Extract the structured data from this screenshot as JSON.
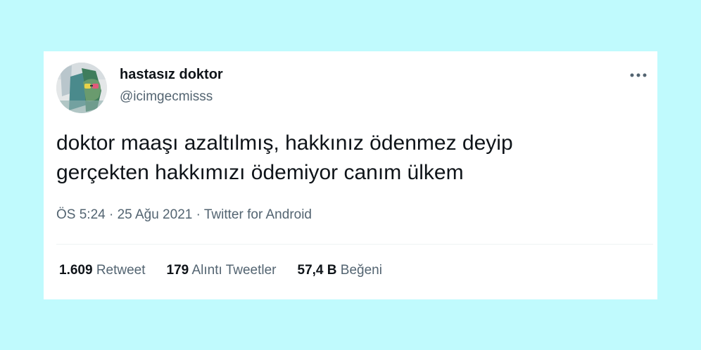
{
  "user": {
    "display_name": "hastasız doktor",
    "handle": "@icimgecmisss",
    "avatar_icon": "profile-photo"
  },
  "tweet": {
    "lines": [
      "doktor maaşı azaltılmış, hakkınız ödenmez deyip",
      "gerçekten hakkımızı ödemiyor canım ülkem"
    ]
  },
  "meta": {
    "time": "ÖS 5:24",
    "sep1": "·",
    "date": "25 Ağu 2021",
    "sep2": "·",
    "source": "Twitter for Android"
  },
  "stats": {
    "retweets": {
      "count": "1.609",
      "label": "Retweet"
    },
    "quotes": {
      "count": "179",
      "label": "Alıntı Tweetler"
    },
    "likes": {
      "count": "57,4 B",
      "label": "Beğeni"
    }
  },
  "colors": {
    "page_background": "#c0fafd",
    "card_background": "#ffffff",
    "primary_text": "#0f1419",
    "secondary_text": "#536471"
  },
  "icons": {
    "more": "more-horizontal-icon"
  }
}
